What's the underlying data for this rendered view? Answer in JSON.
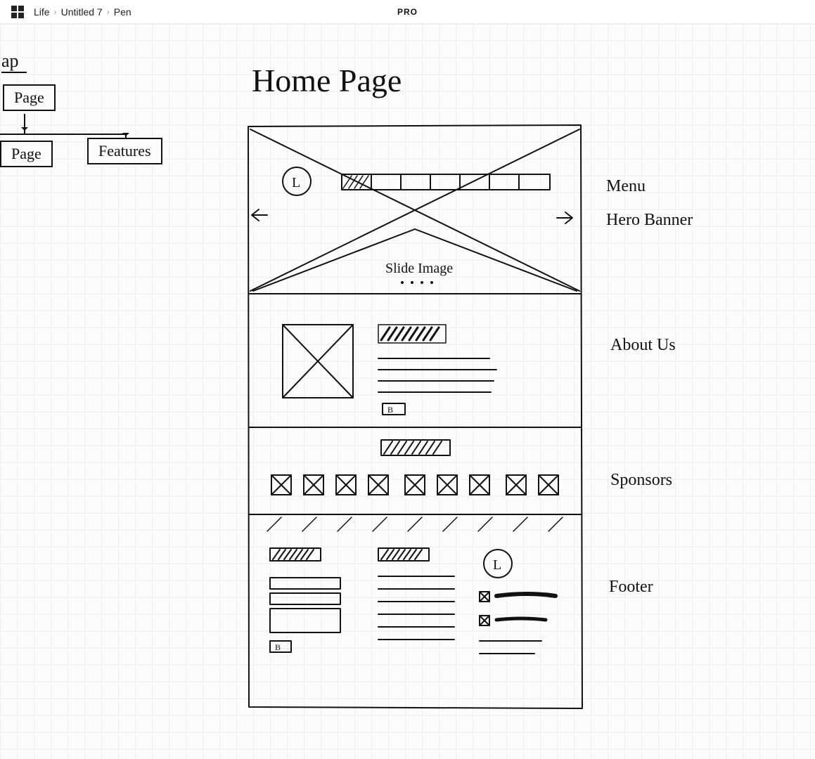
{
  "topbar": {
    "breadcrumbs": [
      "Life",
      "Untitled 7",
      "Pen"
    ],
    "badge": "PRO"
  },
  "canvas": {
    "title": "Home Page",
    "sitemap": {
      "partial_top": "ap",
      "node_page_top": "Page",
      "node_page_bottom": "Page",
      "node_features": "Features"
    },
    "wireframe": {
      "logo_letter": "L",
      "slide_label": "Slide Image",
      "about_button": "B",
      "footer_button": "B"
    },
    "annotations": {
      "menu": "Menu",
      "hero": "Hero Banner",
      "about": "About Us",
      "sponsors": "Sponsors",
      "footer": "Footer"
    }
  }
}
